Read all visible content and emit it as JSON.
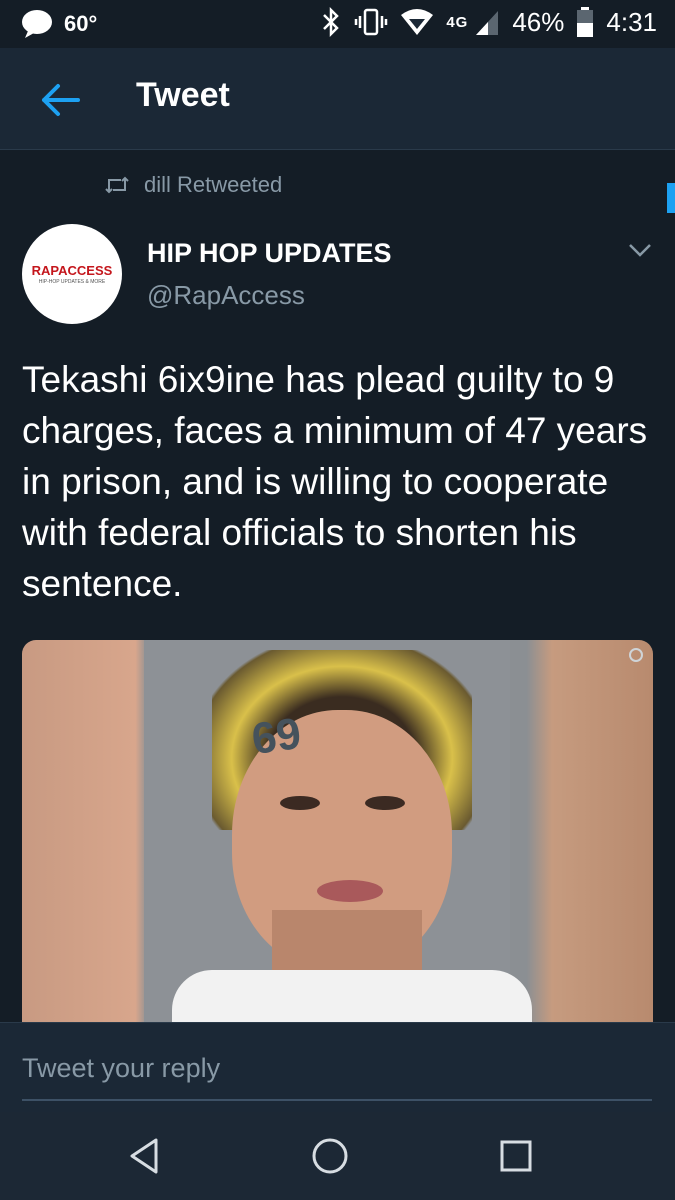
{
  "status_bar": {
    "temperature": "60°",
    "network": "4G",
    "battery": "46%",
    "time": "4:31"
  },
  "app_bar": {
    "title": "Tweet"
  },
  "retweet": {
    "label": "dill Retweeted"
  },
  "tweet": {
    "avatar_logo": "RAPACCESS",
    "avatar_logo_sub": "HIP-HOP UPDATES & MORE",
    "author_name": "HIP HOP UPDATES",
    "author_handle": "@RapAccess",
    "text": "Tekashi 6ix9ine has plead guilty to 9 charges, faces a minimum of 47 years in prison, and is willing to cooperate with federal officials to shorten his sentence.",
    "media_tattoo": "69"
  },
  "reply": {
    "placeholder": "Tweet your reply"
  },
  "colors": {
    "background": "#141d26",
    "header": "#1b2836",
    "accent": "#1da1f2",
    "secondary_text": "#8899a6"
  },
  "icons": [
    "message-bubble-icon",
    "bluetooth-icon",
    "vibrate-icon",
    "wifi-icon",
    "signal-icon",
    "battery-icon",
    "back-arrow-icon",
    "retweet-icon",
    "chevron-down-icon",
    "nav-back-icon",
    "nav-home-icon",
    "nav-recents-icon"
  ]
}
